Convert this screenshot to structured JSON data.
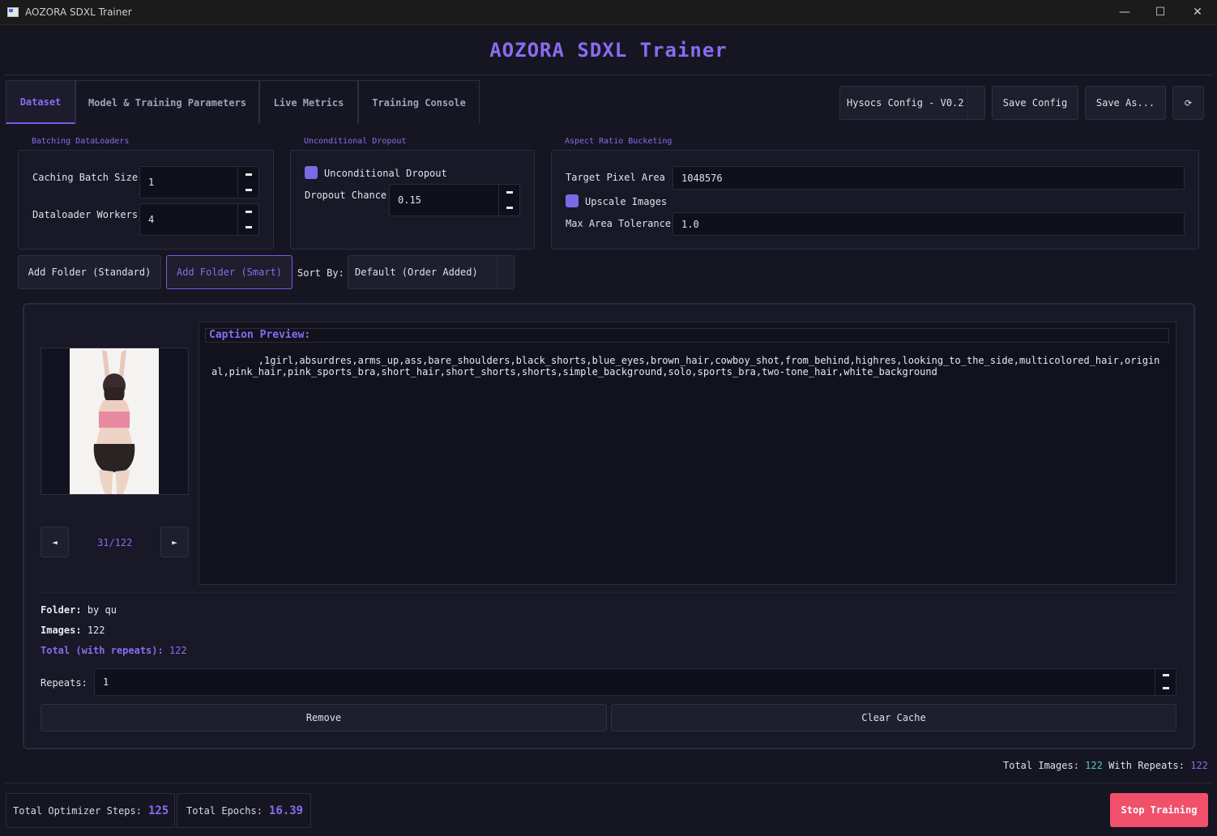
{
  "window": {
    "title": "AOZORA SDXL Trainer",
    "minimize_glyph": "—",
    "maximize_glyph": "☐",
    "close_glyph": "✕"
  },
  "app_title": "AOZORA SDXL Trainer",
  "tabs": [
    {
      "label": "Dataset"
    },
    {
      "label": "Model & Training Parameters"
    },
    {
      "label": "Live Metrics"
    },
    {
      "label": "Training Console"
    }
  ],
  "config": {
    "selected": "Hysocs Config - V0.2",
    "save_label": "Save Config",
    "save_as_label": "Save As...",
    "restore_glyph": "⟳"
  },
  "batching": {
    "title": "Batching  DataLoaders",
    "caching_batch_size_label": "Caching Batch Size",
    "caching_batch_size": "1",
    "dataloader_workers_label": "Dataloader Workers",
    "dataloader_workers": "4"
  },
  "dropout": {
    "title": "Unconditional Dropout",
    "checkbox_label": "Unconditional Dropout",
    "chance_label": "Dropout Chance",
    "chance": "0.15"
  },
  "bucketing": {
    "title": "Aspect Ratio Bucketing",
    "target_area_label": "Target Pixel Area",
    "target_area": "1048576",
    "upscale_label": "Upscale Images",
    "tolerance_label": "Max Area Tolerance",
    "tolerance": "1.0"
  },
  "folder_bar": {
    "add_standard": "Add Folder (Standard)",
    "add_smart": "Add Folder (Smart)",
    "sort_label": "Sort By:",
    "sort_value": "Default (Order Added)"
  },
  "preview": {
    "counter": "31/122",
    "prev_glyph": "◄",
    "next_glyph": "►"
  },
  "caption": {
    "heading": "Caption Preview:",
    "text": "        ,1girl,absurdres,arms_up,ass,bare_shoulders,black_shorts,blue_eyes,brown_hair,cowboy_shot,from_behind,highres,looking_to_the_side,multicolored_hair,original,pink_hair,pink_sports_bra,short_hair,short_shorts,shorts,simple_background,solo,sports_bra,two-tone_hair,white_background"
  },
  "folder_info": {
    "folder_label": "Folder:",
    "folder_value": "by qu",
    "images_label": "Images:",
    "images_value": "122",
    "total_label": "Total (with repeats):",
    "total_value": "122",
    "repeats_label": "Repeats:",
    "repeats_value": "1",
    "remove_label": "Remove",
    "clear_cache_label": "Clear Cache"
  },
  "totals": {
    "total_images_label": "Total Images:",
    "total_images_value": "122",
    "with_repeats_label": "With Repeats:",
    "with_repeats_value": "122"
  },
  "status": {
    "steps_label": "Total Optimizer Steps:",
    "steps_value": "125",
    "epochs_label": "Total Epochs:",
    "epochs_value": "16.39",
    "stop_label": "Stop Training"
  },
  "colors": {
    "accent": "#8a6cf0",
    "teal": "#4ec9c0",
    "stop": "#f0506a",
    "background": "#161622"
  }
}
